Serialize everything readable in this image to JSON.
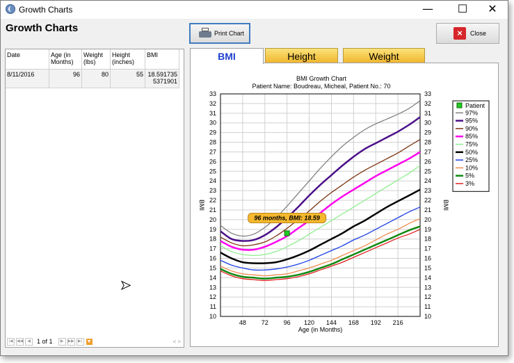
{
  "window": {
    "title": "Growth Charts",
    "minimize": "—",
    "maximize": "☐",
    "close": "✕"
  },
  "page_heading": "Growth Charts",
  "toolbar": {
    "print_label": "Print Chart",
    "close_label": "Close"
  },
  "grid": {
    "columns": [
      "Date",
      "Age (in Months)",
      "Weight (lbs)",
      "Height (inches)",
      "BMI"
    ],
    "rows": [
      [
        "8/11/2016",
        "96",
        "80",
        "55",
        "18.5917355371901"
      ]
    ],
    "pager_text": "1 of 1"
  },
  "tabs": [
    {
      "label": "BMI"
    },
    {
      "label": "Height"
    },
    {
      "label": "Weight"
    }
  ],
  "chart_data": {
    "type": "line",
    "title": "BMI Growth Chart",
    "subtitle": "Patient Name: Boudreau, Micheal, Patient No.: 70",
    "xlabel": "Age (in Months)",
    "ylabel": "BMI",
    "xlim": [
      24,
      240
    ],
    "ylim": [
      10,
      33
    ],
    "x_ticks": [
      48,
      72,
      96,
      120,
      144,
      168,
      192,
      216
    ],
    "y_ticks": [
      10,
      11,
      12,
      13,
      14,
      15,
      16,
      17,
      18,
      19,
      20,
      21,
      22,
      23,
      24,
      25,
      26,
      27,
      28,
      29,
      30,
      31,
      32,
      33
    ],
    "grid": true,
    "legend_position": "right",
    "x": [
      24,
      36,
      48,
      60,
      72,
      84,
      96,
      108,
      120,
      132,
      144,
      156,
      168,
      180,
      192,
      204,
      216,
      228,
      240
    ],
    "series": [
      {
        "name": "97%",
        "color": "#808080",
        "values": [
          19.4,
          18.6,
          18.3,
          18.5,
          19.2,
          20.2,
          21.4,
          22.7,
          24.0,
          25.3,
          26.5,
          27.6,
          28.5,
          29.3,
          29.9,
          30.4,
          30.9,
          31.5,
          32.3
        ]
      },
      {
        "name": "95%",
        "color": "#4b0f8a",
        "values": [
          18.8,
          18.0,
          17.8,
          17.9,
          18.4,
          19.2,
          20.2,
          21.3,
          22.5,
          23.6,
          24.6,
          25.6,
          26.5,
          27.3,
          27.9,
          28.5,
          29.1,
          29.8,
          30.6
        ]
      },
      {
        "name": "90%",
        "color": "#7b3310",
        "values": [
          18.2,
          17.6,
          17.3,
          17.4,
          17.7,
          18.3,
          19.1,
          20.0,
          20.9,
          21.9,
          22.8,
          23.6,
          24.4,
          25.1,
          25.7,
          26.3,
          26.9,
          27.6,
          28.3
        ]
      },
      {
        "name": "85%",
        "color": "#ff00ee",
        "values": [
          17.8,
          17.2,
          16.9,
          16.9,
          17.2,
          17.7,
          18.3,
          19.1,
          19.9,
          20.7,
          21.6,
          22.4,
          23.1,
          23.8,
          24.5,
          25.1,
          25.7,
          26.3,
          27.0
        ]
      },
      {
        "name": "75%",
        "color": "#90ee90",
        "values": [
          17.3,
          16.7,
          16.4,
          16.3,
          16.4,
          16.7,
          17.2,
          17.8,
          18.5,
          19.2,
          19.9,
          20.6,
          21.3,
          22.0,
          22.7,
          23.4,
          24.1,
          24.8,
          25.6
        ]
      },
      {
        "name": "50%",
        "color": "#000000",
        "values": [
          16.6,
          16.0,
          15.6,
          15.5,
          15.5,
          15.6,
          15.9,
          16.3,
          16.8,
          17.4,
          18.0,
          18.6,
          19.3,
          19.9,
          20.6,
          21.3,
          21.9,
          22.5,
          23.1
        ]
      },
      {
        "name": "25%",
        "color": "#1a3de6",
        "values": [
          15.8,
          15.3,
          15.0,
          14.8,
          14.8,
          14.9,
          15.1,
          15.4,
          15.8,
          16.3,
          16.8,
          17.3,
          17.9,
          18.4,
          19.0,
          19.6,
          20.2,
          20.8,
          21.3
        ]
      },
      {
        "name": "10%",
        "color": "#f08c50",
        "values": [
          15.2,
          14.7,
          14.4,
          14.3,
          14.2,
          14.3,
          14.4,
          14.7,
          15.0,
          15.4,
          15.8,
          16.3,
          16.8,
          17.3,
          17.9,
          18.5,
          19.0,
          19.6,
          20.1
        ]
      },
      {
        "name": "5%",
        "color": "#118811",
        "values": [
          14.9,
          14.4,
          14.1,
          14.0,
          13.9,
          14.0,
          14.1,
          14.3,
          14.6,
          15.0,
          15.4,
          15.9,
          16.4,
          16.9,
          17.4,
          17.9,
          18.4,
          18.9,
          19.3
        ]
      },
      {
        "name": "3%",
        "color": "#e02020",
        "values": [
          14.7,
          14.2,
          13.9,
          13.8,
          13.7,
          13.8,
          13.9,
          14.1,
          14.4,
          14.8,
          15.2,
          15.6,
          16.1,
          16.6,
          17.1,
          17.6,
          18.1,
          18.5,
          19.0
        ]
      }
    ],
    "patient": {
      "name": "Patient",
      "x": 96,
      "y": 18.59,
      "color": "#22cc22"
    },
    "tooltip": "96 months, BMI: 18.59"
  }
}
